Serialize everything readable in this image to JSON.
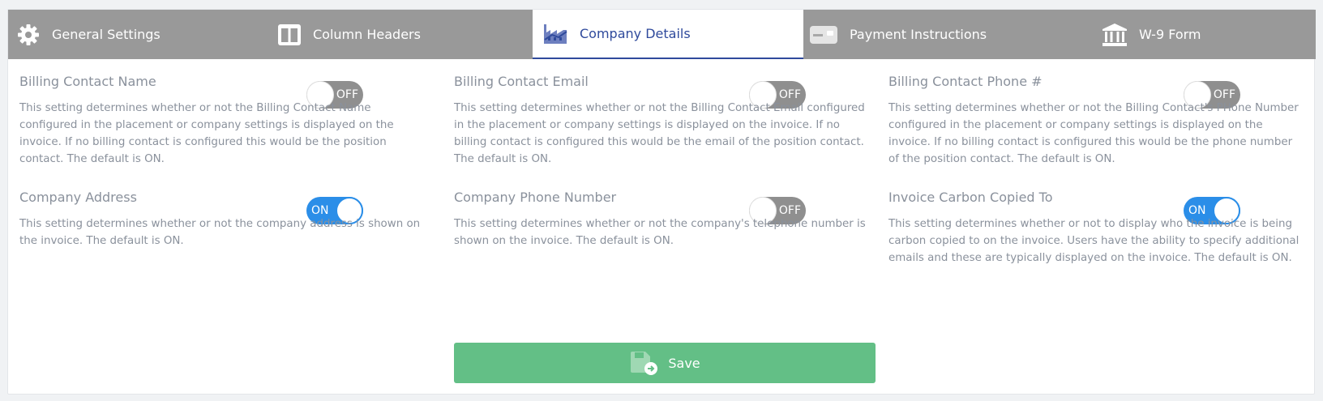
{
  "tabs": [
    {
      "label": "General Settings",
      "icon": "gear-icon",
      "active": false
    },
    {
      "label": "Column Headers",
      "icon": "columns-icon",
      "active": false
    },
    {
      "label": "Company Details",
      "icon": "factory-icon",
      "active": true
    },
    {
      "label": "Payment Instructions",
      "icon": "credit-card-icon",
      "active": false
    },
    {
      "label": "W-9 Form",
      "icon": "bank-icon",
      "active": false
    }
  ],
  "settings": [
    {
      "title": "Billing Contact Name",
      "state": "OFF",
      "description": "This setting determines whether or not the Billing Contact Name configured in the placement or company settings is displayed on the invoice. If no billing contact is configured this would be the position contact. The default is ON."
    },
    {
      "title": "Billing Contact Email",
      "state": "OFF",
      "description": "This setting determines whether or not the Billing Contact Email configured in the placement or company settings is displayed on the invoice. If no billing contact is configured this would be the email of the position contact. The default is ON."
    },
    {
      "title": "Billing Contact Phone #",
      "state": "OFF",
      "description": "This setting determines whether or not the Billing Contact's PHone Number configured in the placement or company settings is displayed on the invoice. If no billing contact is configured this would be the phone number of the position contact. The default is ON."
    },
    {
      "title": "Company Address",
      "state": "ON",
      "description": "This setting determines whether or not the company address is shown on the invoice. The default is ON."
    },
    {
      "title": "Company Phone Number",
      "state": "OFF",
      "description": "This setting determines whether or not the company's telephone number is shown on the invoice. The default is ON."
    },
    {
      "title": "Invoice Carbon Copied To",
      "state": "ON",
      "description": "This setting determines whether or not to display who the invoice is being carbon copied to on the invoice. Users have the ability to specify additional emails and these are typically displayed on the invoice. The default is ON."
    }
  ],
  "save": {
    "label": "Save",
    "icon": "save-icon"
  },
  "colors": {
    "tabbar": "#999999",
    "active_tab_text": "#2f4a9c",
    "toggle_on": "#2b8ee8",
    "toggle_off": "#8f8f8f",
    "save_button": "#63bf86"
  }
}
